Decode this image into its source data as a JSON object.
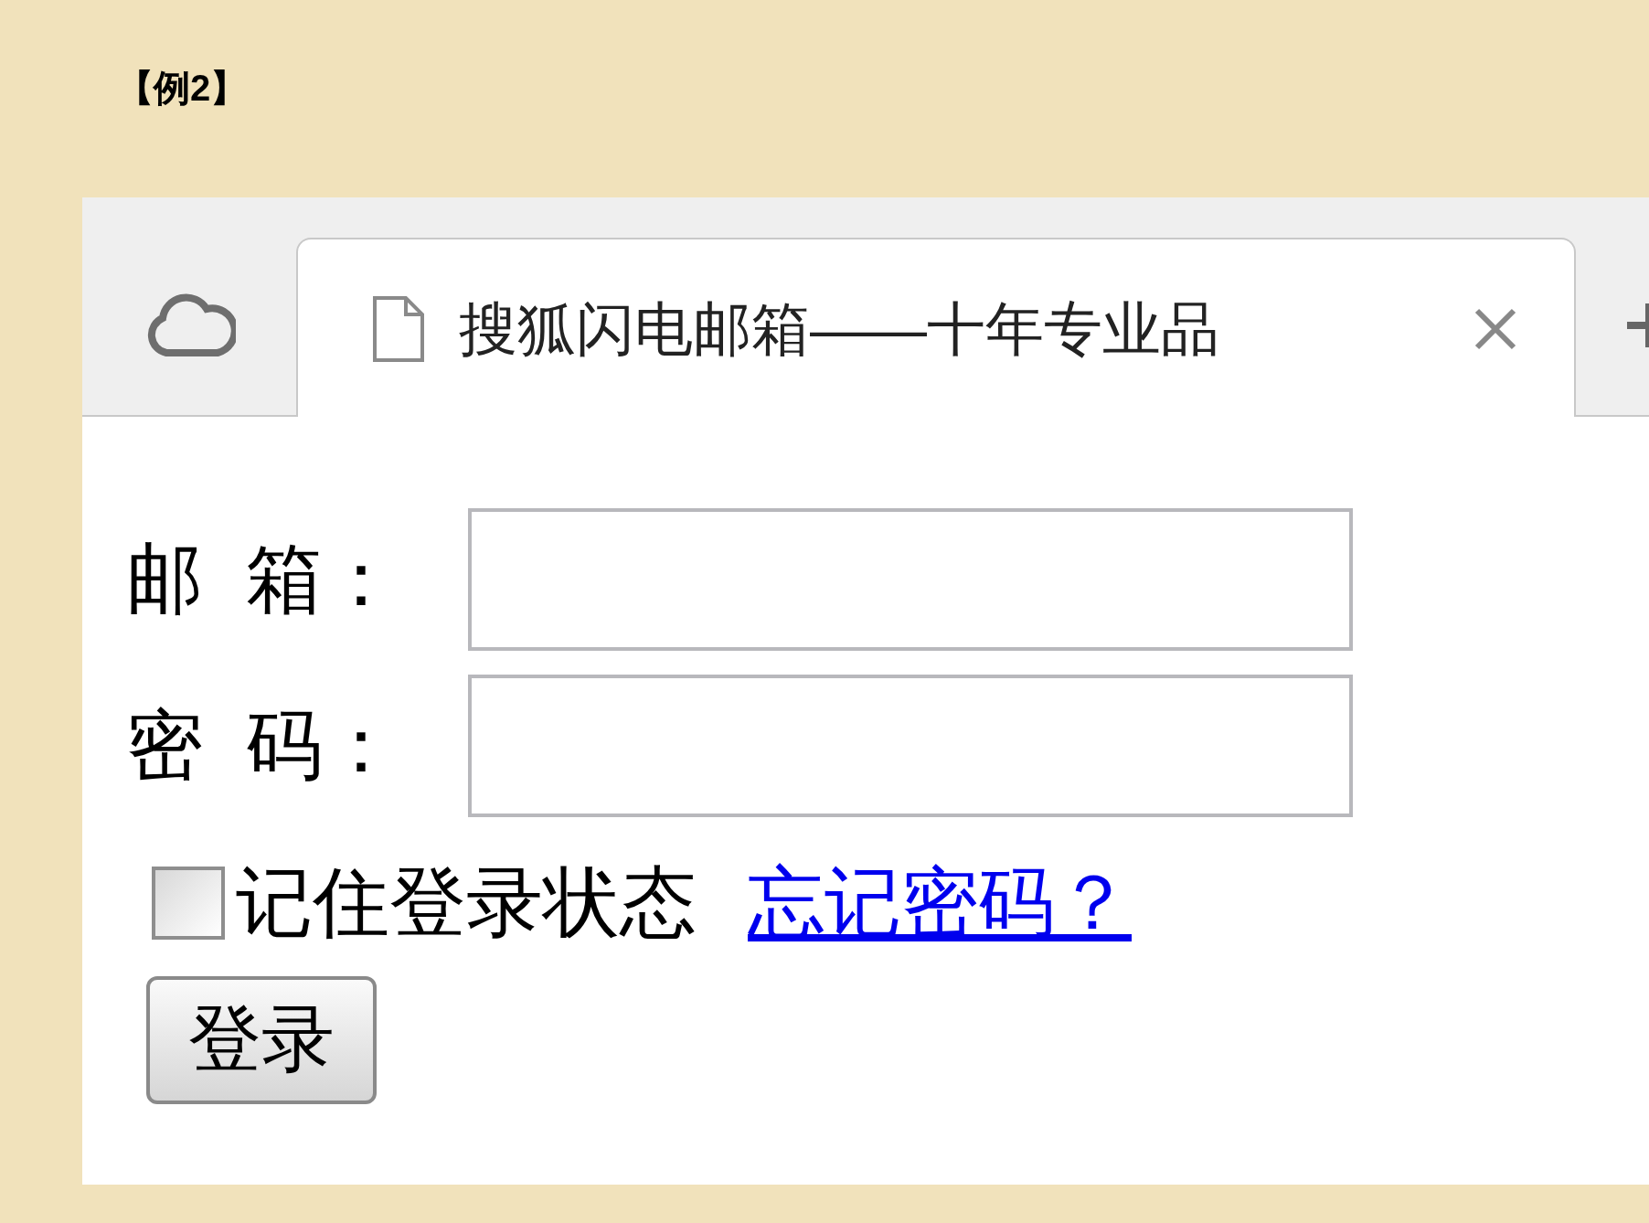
{
  "heading": "【例2】",
  "browser": {
    "tab": {
      "title": "搜狐闪电邮箱——十年专业品",
      "selected": true
    }
  },
  "form": {
    "fields": [
      {
        "label": "邮  箱："
      },
      {
        "label": "密  码："
      }
    ],
    "remember": {
      "label": "记住登录状态",
      "checked": false
    },
    "forgot_link": "忘记密码？",
    "submit": "登录"
  }
}
